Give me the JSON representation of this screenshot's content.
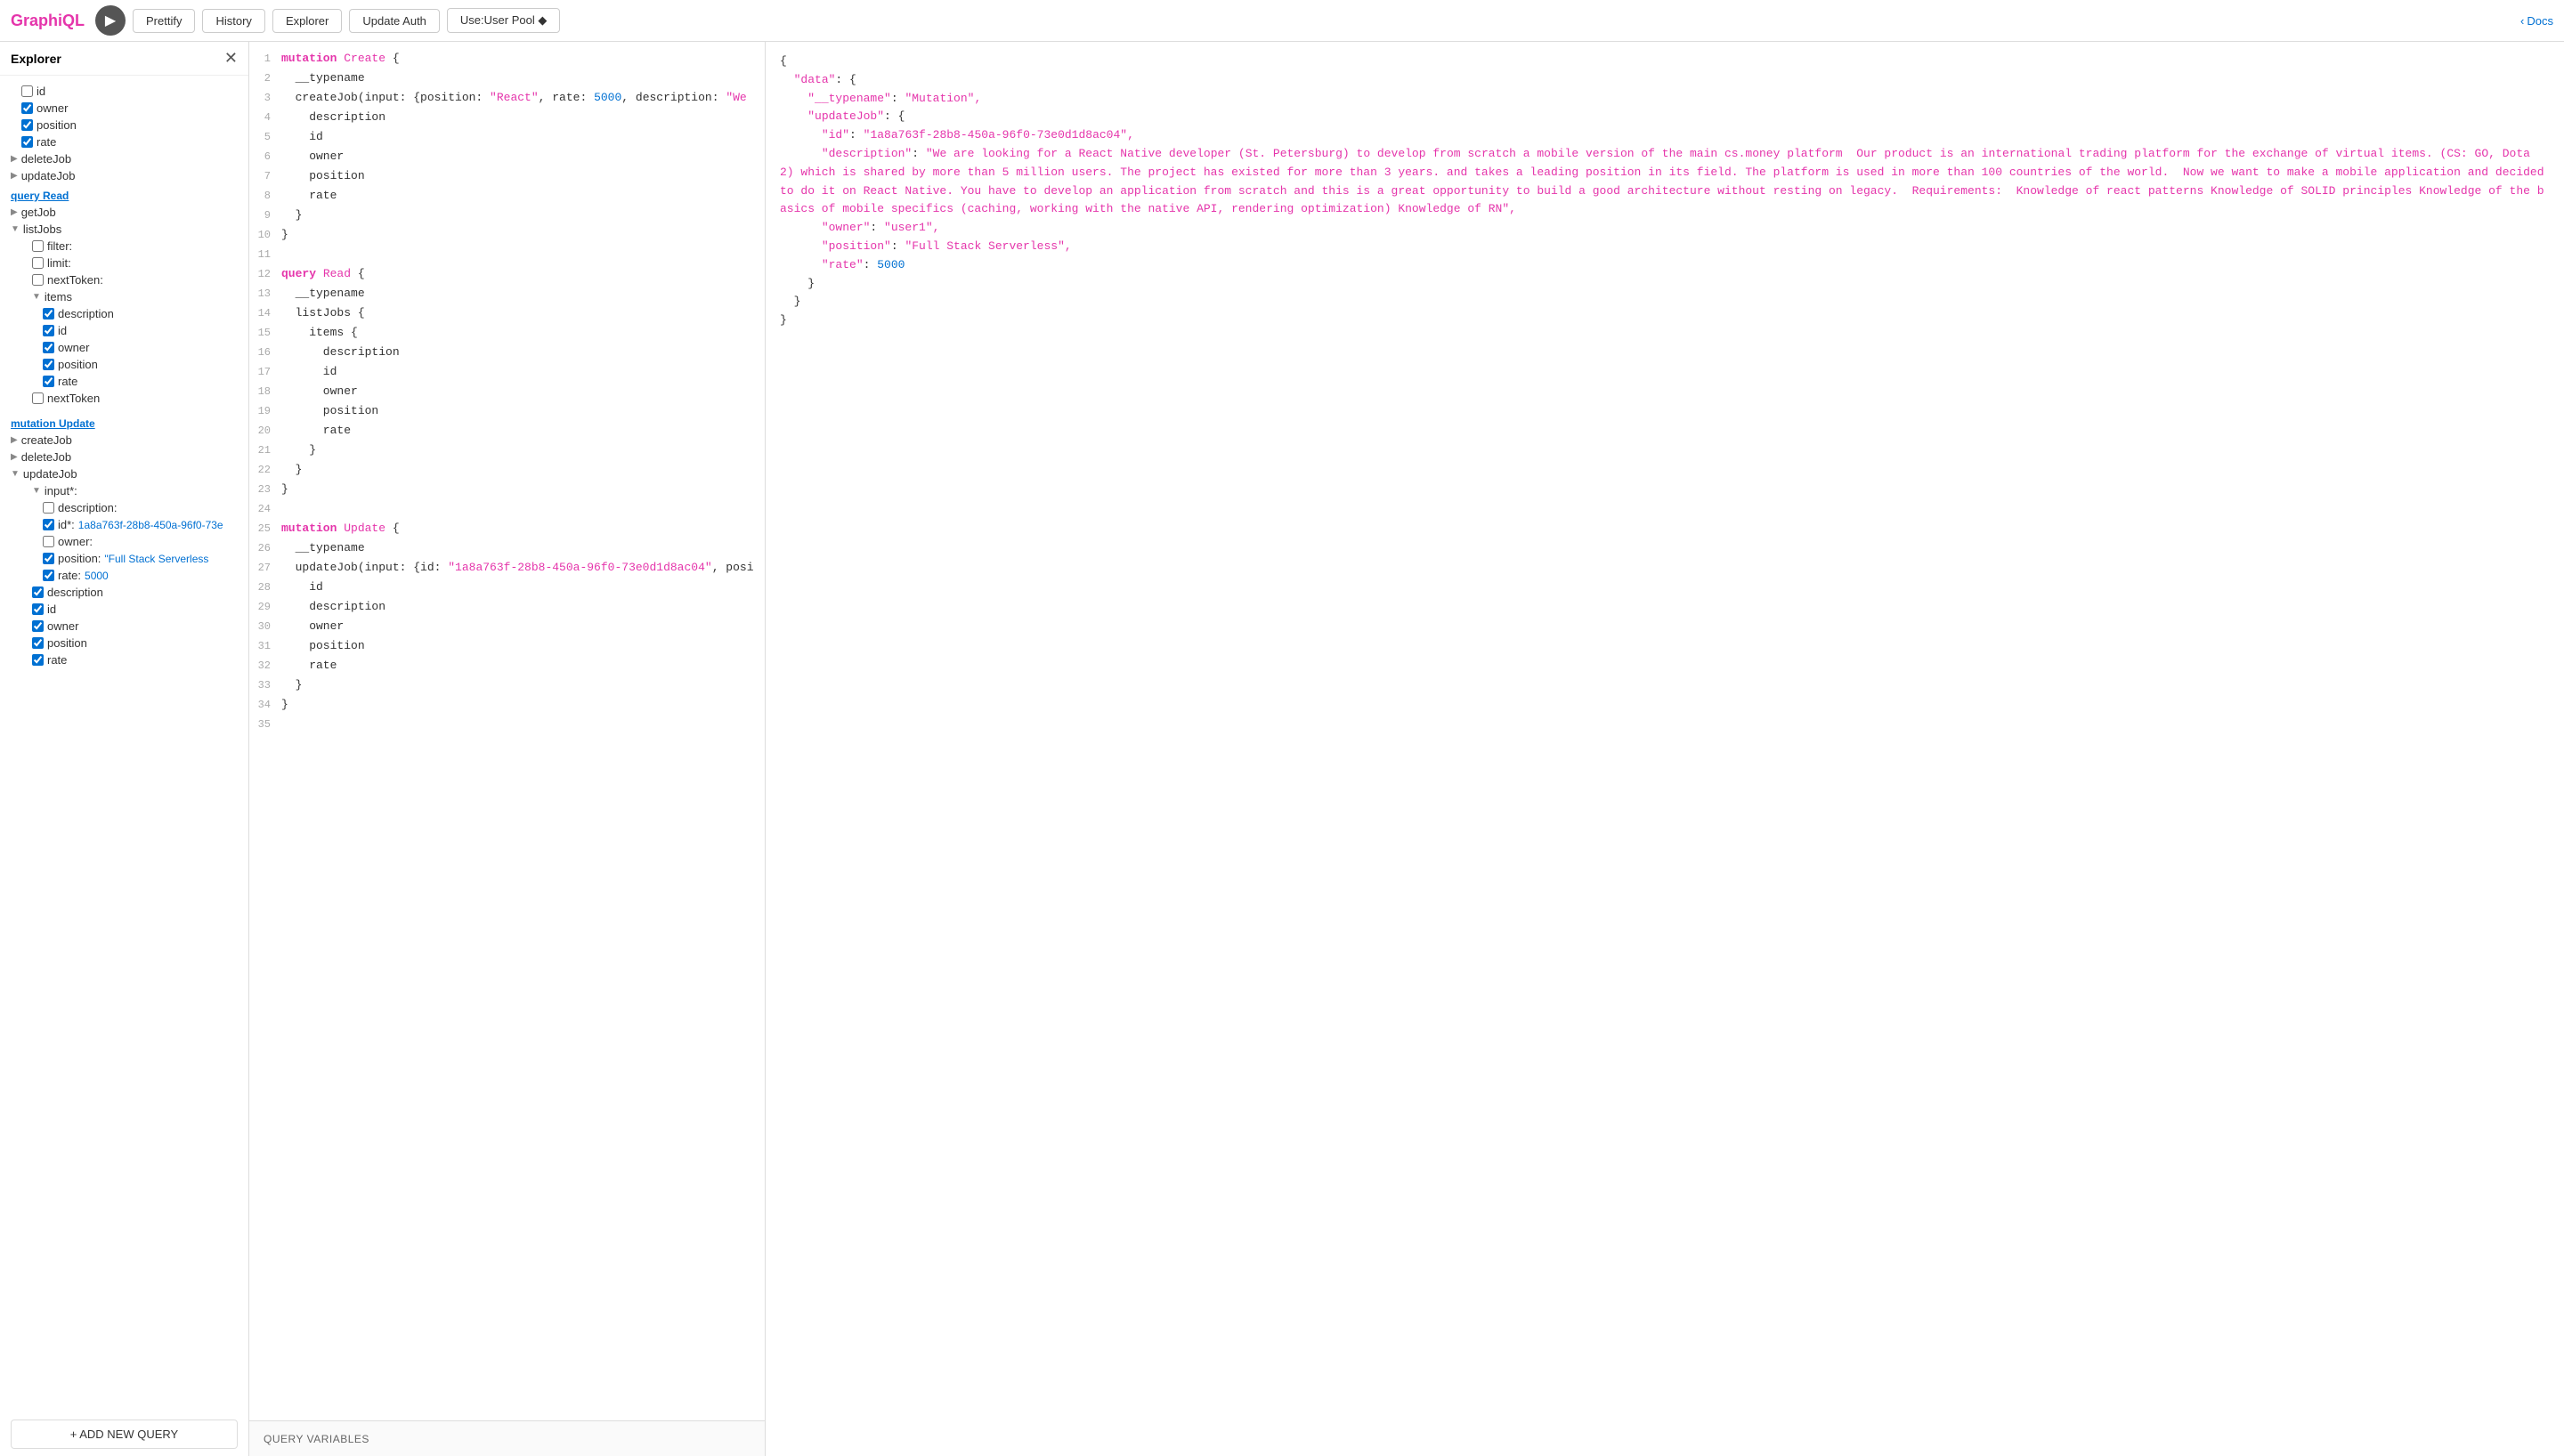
{
  "brand": "GraphiQL",
  "toolbar": {
    "run_label": "▶",
    "prettify_label": "Prettify",
    "history_label": "History",
    "explorer_label": "Explorer",
    "update_auth_label": "Update Auth",
    "use_user_pool_label": "Use:User Pool ◆",
    "docs_label": "Docs"
  },
  "sidebar": {
    "title": "Explorer",
    "sections": [
      {
        "type": "query",
        "label": "query",
        "label_underline": "Read",
        "items": [
          {
            "type": "arrow-item",
            "indent": 0,
            "label": "getJob"
          },
          {
            "type": "arrow-item",
            "indent": 0,
            "label": "listJobs",
            "expanded": true
          },
          {
            "type": "check-item",
            "indent": 1,
            "label": "filter:",
            "checked": false
          },
          {
            "type": "check-item",
            "indent": 1,
            "label": "limit:",
            "checked": false
          },
          {
            "type": "check-item",
            "indent": 1,
            "label": "nextToken:",
            "checked": false
          },
          {
            "type": "arrow-item",
            "indent": 1,
            "label": "items",
            "expanded": true
          },
          {
            "type": "check-item",
            "indent": 2,
            "label": "description",
            "checked": true
          },
          {
            "type": "check-item",
            "indent": 2,
            "label": "id",
            "checked": true
          },
          {
            "type": "check-item",
            "indent": 2,
            "label": "owner",
            "checked": true
          },
          {
            "type": "check-item",
            "indent": 2,
            "label": "position",
            "checked": true
          },
          {
            "type": "check-item",
            "indent": 2,
            "label": "rate",
            "checked": true
          },
          {
            "type": "check-item",
            "indent": 1,
            "label": "nextToken",
            "checked": false
          }
        ]
      },
      {
        "type": "mutation",
        "label": "mutation",
        "label_underline": "Update",
        "items": [
          {
            "type": "arrow-item",
            "indent": 0,
            "label": "createJob"
          },
          {
            "type": "arrow-item",
            "indent": 0,
            "label": "deleteJob"
          },
          {
            "type": "arrow-item",
            "indent": 0,
            "label": "updateJob",
            "expanded": true
          },
          {
            "type": "arrow-item",
            "indent": 1,
            "label": "input*:",
            "expanded": true
          },
          {
            "type": "check-item",
            "indent": 2,
            "label": "description:",
            "checked": false
          },
          {
            "type": "check-item",
            "indent": 2,
            "label": "id*:",
            "checked": true,
            "value_link": "1a8a763f-28b8-450a-96f0-73e"
          },
          {
            "type": "check-item",
            "indent": 2,
            "label": "owner:",
            "checked": false
          },
          {
            "type": "check-item",
            "indent": 2,
            "label": "position:",
            "checked": true,
            "value_link": "\"Full Stack Serverless"
          },
          {
            "type": "check-item",
            "indent": 2,
            "label": "rate:",
            "checked": true,
            "value_link": "5000"
          },
          {
            "type": "check-item",
            "indent": 1,
            "label": "description",
            "checked": true
          },
          {
            "type": "check-item",
            "indent": 1,
            "label": "id",
            "checked": true
          },
          {
            "type": "check-item",
            "indent": 1,
            "label": "owner",
            "checked": true
          },
          {
            "type": "check-item",
            "indent": 1,
            "label": "position",
            "checked": true
          },
          {
            "type": "check-item",
            "indent": 1,
            "label": "rate",
            "checked": true
          }
        ]
      }
    ],
    "top_items": [
      {
        "label": "id",
        "checked": false
      },
      {
        "label": "owner",
        "checked": true
      },
      {
        "label": "position",
        "checked": true
      },
      {
        "label": "rate",
        "checked": true
      }
    ],
    "add_query_label": "+ ADD NEW QUERY"
  },
  "editor": {
    "lines": [
      {
        "num": 1,
        "content": "mutation Create {",
        "tokens": [
          {
            "text": "mutation ",
            "cls": "kw-mutation"
          },
          {
            "text": "Create",
            "cls": "kw-name"
          },
          {
            "text": " {",
            "cls": "kw-field"
          }
        ]
      },
      {
        "num": 2,
        "content": "  __typename",
        "tokens": [
          {
            "text": "  __typename",
            "cls": "kw-field"
          }
        ]
      },
      {
        "num": 3,
        "content": "  createJob(input: {position: \"React\", rate: 5000, description: \"We",
        "tokens": [
          {
            "text": "  createJob(input: {position: ",
            "cls": "kw-field"
          },
          {
            "text": "\"React\"",
            "cls": "kw-string"
          },
          {
            "text": ", rate: ",
            "cls": "kw-field"
          },
          {
            "text": "5000",
            "cls": "kw-number"
          },
          {
            "text": ", description: ",
            "cls": "kw-field"
          },
          {
            "text": "\"We",
            "cls": "kw-string"
          }
        ]
      },
      {
        "num": 4,
        "content": "    description",
        "tokens": [
          {
            "text": "    description",
            "cls": "kw-field"
          }
        ]
      },
      {
        "num": 5,
        "content": "    id",
        "tokens": [
          {
            "text": "    id",
            "cls": "kw-field"
          }
        ]
      },
      {
        "num": 6,
        "content": "    owner",
        "tokens": [
          {
            "text": "    owner",
            "cls": "kw-field"
          }
        ]
      },
      {
        "num": 7,
        "content": "    position",
        "tokens": [
          {
            "text": "    position",
            "cls": "kw-field"
          }
        ]
      },
      {
        "num": 8,
        "content": "    rate",
        "tokens": [
          {
            "text": "    rate",
            "cls": "kw-field"
          }
        ]
      },
      {
        "num": 9,
        "content": "  }",
        "tokens": [
          {
            "text": "  }",
            "cls": "kw-field"
          }
        ]
      },
      {
        "num": 10,
        "content": "}",
        "tokens": [
          {
            "text": "}",
            "cls": "kw-field"
          }
        ]
      },
      {
        "num": 11,
        "content": "",
        "tokens": []
      },
      {
        "num": 12,
        "content": "query Read {",
        "tokens": [
          {
            "text": "query ",
            "cls": "kw-query"
          },
          {
            "text": "Read",
            "cls": "kw-name"
          },
          {
            "text": " {",
            "cls": "kw-field"
          }
        ]
      },
      {
        "num": 13,
        "content": "  __typename",
        "tokens": [
          {
            "text": "  __typename",
            "cls": "kw-field"
          }
        ]
      },
      {
        "num": 14,
        "content": "  listJobs {",
        "tokens": [
          {
            "text": "  listJobs {",
            "cls": "kw-field"
          }
        ]
      },
      {
        "num": 15,
        "content": "    items {",
        "tokens": [
          {
            "text": "    items {",
            "cls": "kw-field"
          }
        ]
      },
      {
        "num": 16,
        "content": "      description",
        "tokens": [
          {
            "text": "      description",
            "cls": "kw-field"
          }
        ]
      },
      {
        "num": 17,
        "content": "      id",
        "tokens": [
          {
            "text": "      id",
            "cls": "kw-field"
          }
        ]
      },
      {
        "num": 18,
        "content": "      owner",
        "tokens": [
          {
            "text": "      owner",
            "cls": "kw-field"
          }
        ]
      },
      {
        "num": 19,
        "content": "      position",
        "tokens": [
          {
            "text": "      position",
            "cls": "kw-field"
          }
        ]
      },
      {
        "num": 20,
        "content": "      rate",
        "tokens": [
          {
            "text": "      rate",
            "cls": "kw-field"
          }
        ]
      },
      {
        "num": 21,
        "content": "    }",
        "tokens": [
          {
            "text": "    }",
            "cls": "kw-field"
          }
        ]
      },
      {
        "num": 22,
        "content": "  }",
        "tokens": [
          {
            "text": "  }",
            "cls": "kw-field"
          }
        ]
      },
      {
        "num": 23,
        "content": "}",
        "tokens": [
          {
            "text": "}",
            "cls": "kw-field"
          }
        ]
      },
      {
        "num": 24,
        "content": "",
        "tokens": []
      },
      {
        "num": 25,
        "content": "mutation Update {",
        "tokens": [
          {
            "text": "mutation ",
            "cls": "kw-mutation"
          },
          {
            "text": "Update",
            "cls": "kw-name"
          },
          {
            "text": " {",
            "cls": "kw-field"
          }
        ]
      },
      {
        "num": 26,
        "content": "  __typename",
        "tokens": [
          {
            "text": "  __typename",
            "cls": "kw-field"
          }
        ]
      },
      {
        "num": 27,
        "content": "  updateJob(input: {id: \"1a8a763f-28b8-450a-96f0-73e0d1d8ac04\", posi",
        "tokens": [
          {
            "text": "  updateJob(input: {id: ",
            "cls": "kw-field"
          },
          {
            "text": "\"1a8a763f-28b8-450a-96f0-73e0d1d8ac04\"",
            "cls": "kw-string"
          },
          {
            "text": ", posi",
            "cls": "kw-field"
          }
        ]
      },
      {
        "num": 28,
        "content": "    id",
        "tokens": [
          {
            "text": "    id",
            "cls": "kw-field"
          }
        ]
      },
      {
        "num": 29,
        "content": "    description",
        "tokens": [
          {
            "text": "    description",
            "cls": "kw-field"
          }
        ]
      },
      {
        "num": 30,
        "content": "    owner",
        "tokens": [
          {
            "text": "    owner",
            "cls": "kw-field"
          }
        ]
      },
      {
        "num": 31,
        "content": "    position",
        "tokens": [
          {
            "text": "    position",
            "cls": "kw-field"
          }
        ]
      },
      {
        "num": 32,
        "content": "    rate",
        "tokens": [
          {
            "text": "    rate",
            "cls": "kw-field"
          }
        ]
      },
      {
        "num": 33,
        "content": "  }",
        "tokens": [
          {
            "text": "  }",
            "cls": "kw-field"
          }
        ]
      },
      {
        "num": 34,
        "content": "}",
        "tokens": [
          {
            "text": "}",
            "cls": "kw-field"
          }
        ]
      },
      {
        "num": 35,
        "content": "",
        "tokens": []
      }
    ],
    "query_variables_label": "QUERY VARIABLES"
  },
  "response": {
    "content": "{\n  \"data\": {\n    \"__typename\": \"Mutation\",\n    \"updateJob\": {\n      \"id\": \"1a8a763f-28b8-450a-96f0-73e0d1d8ac04\",\n      \"description\": \"We are looking for a React Native developer (St. Petersburg) to develop from scratch a mobile version of the main cs.money platform  Our product is an international trading platform for the exchange of virtual items. (CS: GO, Dota 2) which is shared by more than 5 million users. The project has existed for more than 3 years. and takes a leading position in its field. The platform is used in more than 100 countries of the world.  Now we want to make a mobile application and decided to do it on React Native. You have to develop an application from scratch and this is a great opportunity to build a good architecture without resting on legacy.  Requirements:  Knowledge of react patterns Knowledge of SOLID principles Knowledge of the basics of mobile specifics (caching, working with the native API, rendering optimization) Knowledge of RN\",\n      \"owner\": \"user1\",\n      \"position\": \"Full Stack Serverless\",\n      \"rate\": 5000\n    }\n  }\n}"
  }
}
